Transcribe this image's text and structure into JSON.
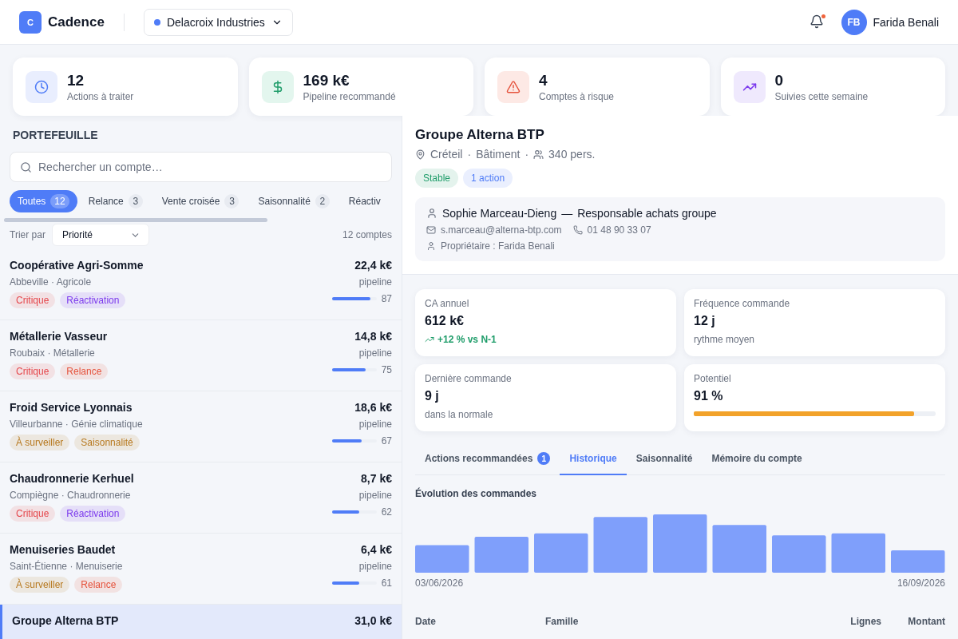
{
  "header": {
    "logo_letter": "C",
    "app_name": "Cadence",
    "company": {
      "name": "Delacroix Industries",
      "color": "#4f7cf7"
    },
    "notifications": {
      "unread": true
    },
    "user": {
      "initials": "FB",
      "name": "Farida Benali"
    }
  },
  "stats": [
    {
      "kind": "clock",
      "value": "12",
      "label": "Actions à traiter"
    },
    {
      "kind": "dollar",
      "value": "169 k€",
      "label": "Pipeline recommandé"
    },
    {
      "kind": "alert",
      "value": "4",
      "label": "Comptes à risque"
    },
    {
      "kind": "trend",
      "value": "0",
      "label": "Suivies cette semaine"
    }
  ],
  "portfolio": {
    "title": "PORTEFEUILLE",
    "search": {
      "placeholder": "Rechercher un compte…"
    },
    "filters": [
      {
        "label": "Toutes",
        "count": "12",
        "selected": true
      },
      {
        "label": "Relance",
        "count": "3",
        "selected": false
      },
      {
        "label": "Vente croisée",
        "count": "3",
        "selected": false
      },
      {
        "label": "Saisonnalité",
        "count": "2",
        "selected": false
      },
      {
        "label": "Réactiv",
        "selected": false
      }
    ],
    "sort_label": "Trier par",
    "sort_value": "Priorité",
    "count_text": "12 comptes",
    "accounts": [
      {
        "name": "Coopérative Agri-Somme",
        "city": "Abbeville",
        "separator": "·",
        "sector": "Agricole",
        "amount": "22,4 k€",
        "amount_label": "pipeline",
        "score": "87",
        "level": 0.87,
        "selected": false,
        "tags": [
          {
            "label": "Critique",
            "color": "#e5484d"
          },
          {
            "label": "Réactivation",
            "color": "#7c3aed"
          }
        ]
      },
      {
        "name": "Métallerie Vasseur",
        "city": "Roubaix",
        "separator": "·",
        "sector": "Métallerie",
        "amount": "14,8 k€",
        "amount_label": "pipeline",
        "score": "75",
        "level": 0.75,
        "selected": false,
        "tags": [
          {
            "label": "Critique",
            "color": "#e5484d"
          },
          {
            "label": "Relance",
            "color": "#e5533d"
          }
        ]
      },
      {
        "name": "Froid Service Lyonnais",
        "city": "Villeurbanne",
        "separator": "·",
        "sector": "Génie climatique",
        "amount": "18,6 k€",
        "amount_label": "pipeline",
        "score": "67",
        "level": 0.67,
        "selected": false,
        "tags": [
          {
            "label": "À surveiller",
            "color": "#b7791f"
          },
          {
            "label": "Saisonnalité",
            "color": "#b7791f"
          }
        ]
      },
      {
        "name": "Chaudronnerie Kerhuel",
        "city": "Compiègne",
        "separator": "·",
        "sector": "Chaudronnerie",
        "amount": "8,7 k€",
        "amount_label": "pipeline",
        "score": "62",
        "level": 0.62,
        "selected": false,
        "tags": [
          {
            "label": "Critique",
            "color": "#e5484d"
          },
          {
            "label": "Réactivation",
            "color": "#7c3aed"
          }
        ]
      },
      {
        "name": "Menuiseries Baudet",
        "city": "Saint-Étienne",
        "separator": "·",
        "sector": "Menuiserie",
        "amount": "6,4 k€",
        "amount_label": "pipeline",
        "score": "61",
        "level": 0.61,
        "selected": false,
        "tags": [
          {
            "label": "À surveiller",
            "color": "#b7791f"
          },
          {
            "label": "Relance",
            "color": "#e5533d"
          }
        ]
      },
      {
        "name": "Groupe Alterna BTP",
        "amount": "31,0 k€",
        "selected": true
      }
    ]
  },
  "detail": {
    "name": "Groupe Alterna BTP",
    "city": "Créteil",
    "separator_1": "·",
    "sector": "Bâtiment",
    "separator_2": "·",
    "headcount": "340 pers.",
    "badges": [
      {
        "label": "Stable",
        "color": "#1f9d6a"
      },
      {
        "label": "1 action",
        "color": "#4f7cf7"
      }
    ],
    "contact": {
      "name": "Sophie Marceau-Dieng",
      "separator": "—",
      "role": "Responsable achats groupe",
      "email": "s.marceau@alterna-btp.com",
      "phone": "01 48 90 33 07",
      "owner": "Propriétaire : Farida Benali"
    },
    "metrics": [
      {
        "kind": "trend",
        "label": "CA annuel",
        "value": "612 k€",
        "note": "+12 % vs N-1"
      },
      {
        "kind": "text",
        "label": "Fréquence commande",
        "value": "12 j",
        "note": "rythme moyen"
      },
      {
        "kind": "text",
        "label": "Dernière commande",
        "value": "9 j",
        "note": "dans la normale"
      },
      {
        "kind": "bar",
        "label": "Potentiel",
        "value": "91 %",
        "level": 0.91
      }
    ],
    "tabs": [
      {
        "label": "Actions recommandées",
        "badge": "1",
        "selected": false
      },
      {
        "label": "Historique",
        "selected": true
      },
      {
        "label": "Saisonnalité",
        "selected": false
      },
      {
        "label": "Mémoire du compte",
        "selected": false
      }
    ],
    "history": {
      "title": "Évolution des commandes",
      "start_date": "03/06/2026",
      "end_date": "16/09/2026",
      "columns": [
        "Date",
        "Famille",
        "Lignes",
        "Montant"
      ]
    }
  }
}
